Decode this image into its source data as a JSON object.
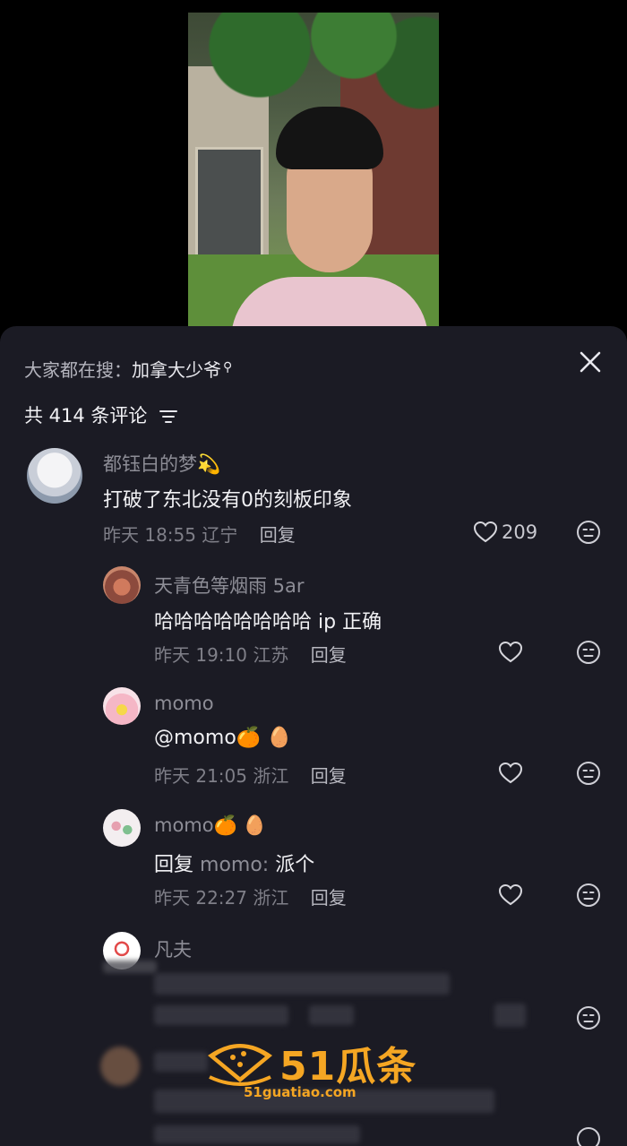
{
  "search_hint": {
    "prefix": "大家都在搜：",
    "term": "加拿大少爷"
  },
  "comment_count_label": "共 414 条评论",
  "comments": [
    {
      "name": "都钰白的梦",
      "name_emoji": "💫",
      "text": "打破了东北没有0的刻板印象",
      "time": "昨天 18:55",
      "location": "辽宁",
      "reply_label": "回复",
      "likes": "209"
    },
    {
      "name": "天青色等烟雨 5ar",
      "text": "哈哈哈哈哈哈哈哈 ip 正确",
      "time": "昨天 19:10",
      "location": "江苏",
      "reply_label": "回复",
      "likes": ""
    },
    {
      "name": "momo",
      "text": "@momo🍊 🥚",
      "time": "昨天 21:05",
      "location": "浙江",
      "reply_label": "回复",
      "likes": ""
    },
    {
      "name": "momo🍊 🥚",
      "text_prefix": "回复",
      "text_target": "momo:",
      "text": "派个",
      "time": "昨天 22:27",
      "location": "浙江",
      "reply_label": "回复",
      "likes": ""
    },
    {
      "name": "凡夫"
    }
  ],
  "watermark": {
    "main": "51瓜条",
    "sub": "51guatiao.com"
  },
  "icons": [
    "search-icon",
    "close-icon",
    "filter-icon",
    "heart-icon",
    "emoji-icon"
  ]
}
